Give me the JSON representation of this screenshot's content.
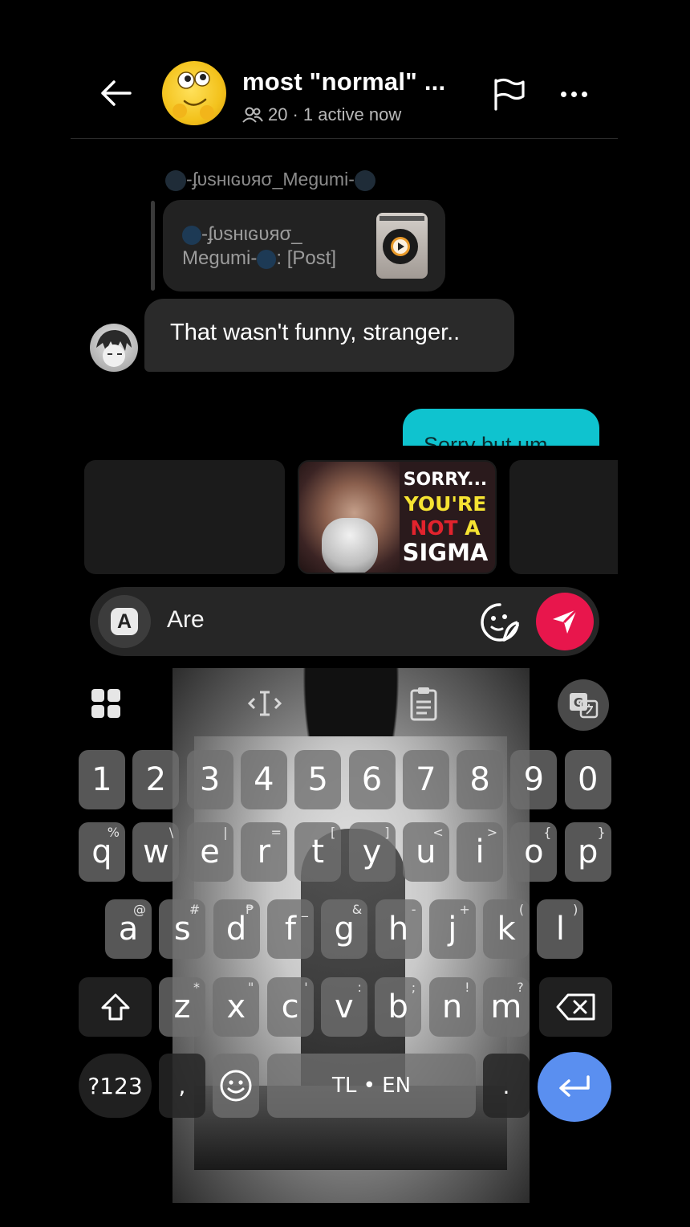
{
  "header": {
    "back_icon": "arrow-left-icon",
    "title": "most \"normal\" ...",
    "members_icon": "people-icon",
    "member_count": "20",
    "active_status": "· 1 active now",
    "flag_icon": "flag-icon",
    "more_icon": "more-horizontal-icon"
  },
  "messages": {
    "reply_author": "-ʄυsнιɢυяσ_Megumi-",
    "reply_snippet_line1": "-ʄυsнιɢυяσ_",
    "reply_snippet_line2": "Megumi-",
    "reply_snippet_suffix": ": [Post]",
    "received_text": "That wasn't funny, stranger..",
    "sent_text_partial": "Sorry but um"
  },
  "gif_strip": {
    "gif2_lines": [
      "SORRY...",
      "YOU'RE",
      "NOT",
      "A",
      "SIGMA"
    ]
  },
  "composer": {
    "sticker_key": "A",
    "input_value": "Are",
    "sticker_icon": "sticker-smile-icon",
    "send_icon": "send-icon",
    "send_color": "#e8164c"
  },
  "keyboard": {
    "toolbar_icons": [
      "apps-grid-icon",
      "text-cursor-icon",
      "clipboard-icon",
      "translate-icon"
    ],
    "numbers": [
      "1",
      "2",
      "3",
      "4",
      "5",
      "6",
      "7",
      "8",
      "9",
      "0"
    ],
    "row1": [
      {
        "k": "q",
        "h": "%"
      },
      {
        "k": "w",
        "h": "\\"
      },
      {
        "k": "e",
        "h": "|"
      },
      {
        "k": "r",
        "h": "="
      },
      {
        "k": "t",
        "h": "["
      },
      {
        "k": "y",
        "h": "]"
      },
      {
        "k": "u",
        "h": "<"
      },
      {
        "k": "i",
        "h": ">"
      },
      {
        "k": "o",
        "h": "{"
      },
      {
        "k": "p",
        "h": "}"
      }
    ],
    "row2": [
      {
        "k": "a",
        "h": "@"
      },
      {
        "k": "s",
        "h": "#"
      },
      {
        "k": "d",
        "h": "₱"
      },
      {
        "k": "f",
        "h": "_"
      },
      {
        "k": "g",
        "h": "&"
      },
      {
        "k": "h",
        "h": "-"
      },
      {
        "k": "j",
        "h": "+"
      },
      {
        "k": "k",
        "h": "("
      },
      {
        "k": "l",
        "h": ")"
      }
    ],
    "row3": [
      {
        "k": "z",
        "h": "*"
      },
      {
        "k": "x",
        "h": "\""
      },
      {
        "k": "c",
        "h": "'"
      },
      {
        "k": "v",
        "h": ":"
      },
      {
        "k": "b",
        "h": ";"
      },
      {
        "k": "n",
        "h": "!"
      },
      {
        "k": "m",
        "h": "?"
      }
    ],
    "symbols_key": "?123",
    "comma_key": ",",
    "space_label": "TL • EN",
    "period_key": ".",
    "enter_color": "#5a8ff0"
  }
}
